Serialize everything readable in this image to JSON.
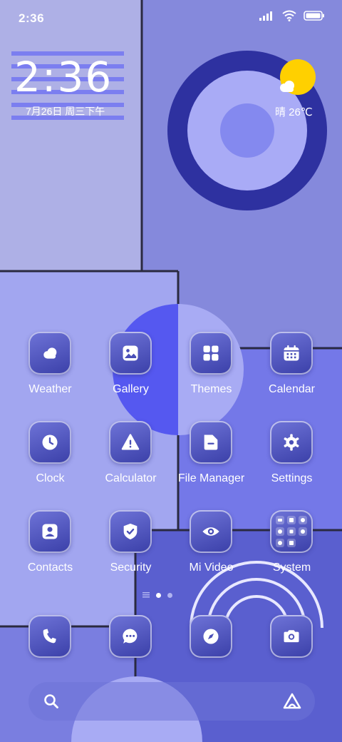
{
  "status_bar": {
    "time": "2:36",
    "icons": [
      "signal-icon",
      "wifi-icon",
      "battery-icon"
    ]
  },
  "clock_widget": {
    "time": "2:36",
    "date": "7月26日 周三下午"
  },
  "weather_widget": {
    "text": "晴 26℃",
    "icon": "sun-cloud-icon"
  },
  "apps": [
    {
      "label": "Weather",
      "icon": "weather-cloud-icon",
      "name": "weather"
    },
    {
      "label": "Gallery",
      "icon": "gallery-icon",
      "name": "gallery"
    },
    {
      "label": "Themes",
      "icon": "themes-grid-icon",
      "name": "themes"
    },
    {
      "label": "Calendar",
      "icon": "calendar-icon",
      "name": "calendar"
    },
    {
      "label": "Clock",
      "icon": "clock-icon",
      "name": "clock"
    },
    {
      "label": "Calculator",
      "icon": "calculator-icon",
      "name": "calculator"
    },
    {
      "label": "File Manager",
      "icon": "folder-icon",
      "name": "file-manager"
    },
    {
      "label": "Settings",
      "icon": "gear-icon",
      "name": "settings"
    },
    {
      "label": "Contacts",
      "icon": "contacts-icon",
      "name": "contacts"
    },
    {
      "label": "Security",
      "icon": "shield-check-icon",
      "name": "security"
    },
    {
      "label": "Mi Video",
      "icon": "eye-icon",
      "name": "mi-video"
    },
    {
      "label": "System",
      "icon": "folder-grid-icon",
      "name": "system"
    }
  ],
  "page_indicator": {
    "pages": 2,
    "current": 1
  },
  "dock": [
    {
      "icon": "phone-icon",
      "name": "phone"
    },
    {
      "icon": "messages-icon",
      "name": "messages"
    },
    {
      "icon": "compass-icon",
      "name": "browser"
    },
    {
      "icon": "camera-icon",
      "name": "camera"
    }
  ],
  "search_bar": {
    "left_icon": "search-icon",
    "right_icon": "assistant-icon"
  },
  "colors": {
    "deep_blue": "#2e31a0",
    "accent_blue": "#5558f0",
    "sun_yellow": "#ffd000",
    "text": "#ffffff"
  }
}
